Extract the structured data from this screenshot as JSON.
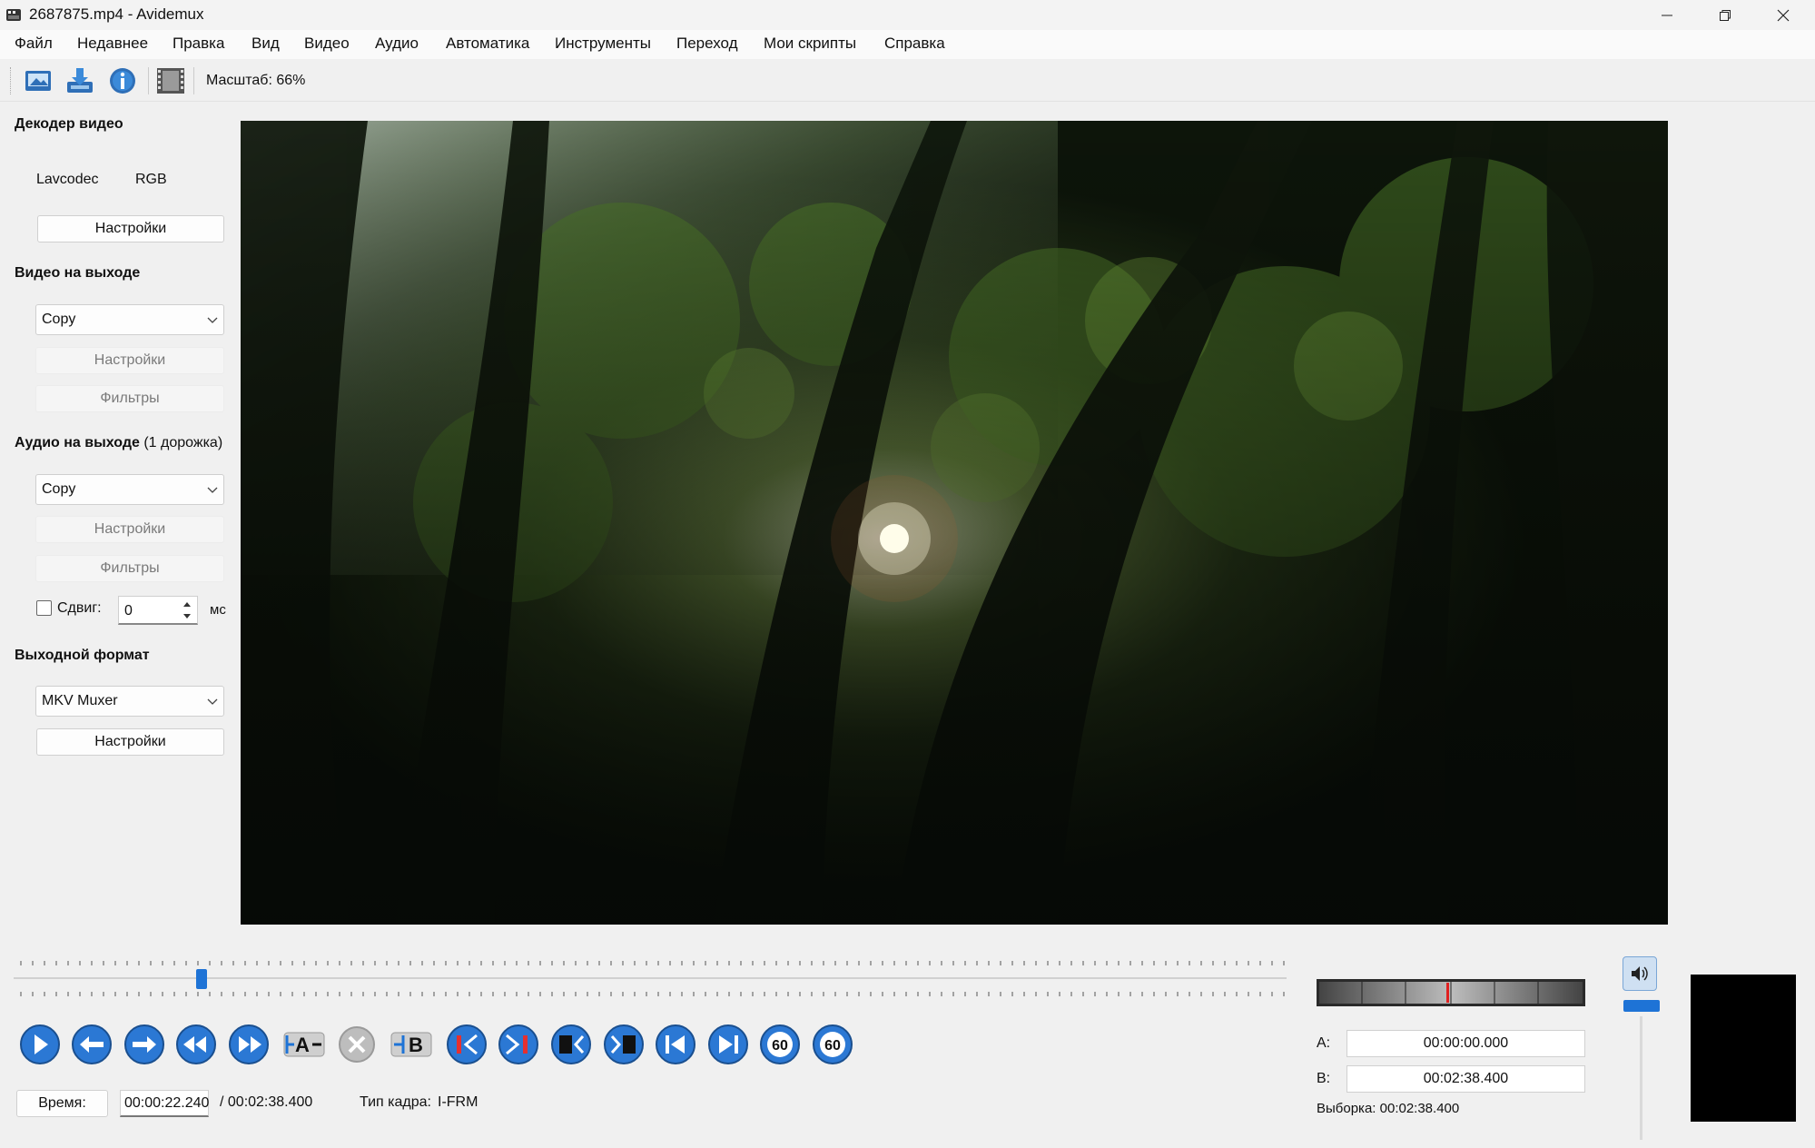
{
  "window": {
    "title": "2687875.mp4 - Avidemux"
  },
  "menu": [
    "Файл",
    "Недавнее",
    "Правка",
    "Вид",
    "Видео",
    "Аудио",
    "Автоматика",
    "Инструменты",
    "Переход",
    "Мои скрипты",
    "Справка"
  ],
  "toolbar": {
    "zoom": "Масштаб: 66%",
    "icons": [
      "open-icon",
      "save-icon",
      "info-icon",
      "filmstrip-icon"
    ]
  },
  "video_decoder": {
    "heading": "Декодер видео",
    "codec": "Lavcodec",
    "colorspace": "RGB",
    "settings": "Настройки"
  },
  "video_output": {
    "heading": "Видео на выходе",
    "codec": "Copy",
    "settings": "Настройки",
    "filters": "Фильтры"
  },
  "audio_output": {
    "heading": "Аудио на выходе",
    "tracks": "(1 дорожка)",
    "codec": "Copy",
    "settings": "Настройки",
    "filters": "Фильтры",
    "offset_label": "Сдвиг:",
    "offset_value": "0",
    "offset_unit": "мс",
    "offset_enabled": false
  },
  "output_format": {
    "heading": "Выходной формат",
    "muxer": "MKV Muxer",
    "settings": "Настройки"
  },
  "playback": {
    "position_fraction": 0.148,
    "time_label": "Время:",
    "current_time": "00:00:22.240",
    "total_time": "/ 00:02:38.400",
    "frame_type_label": "Тип кадра:",
    "frame_type": "I-FRM"
  },
  "transport": {
    "buttons": [
      "play-icon",
      "previous-frame-icon",
      "next-frame-icon",
      "rewind-icon",
      "fast-forward-icon",
      "set-marker-a-icon",
      "delete-icon",
      "set-marker-b-icon",
      "go-to-marker-a-icon",
      "go-to-marker-b-icon",
      "previous-keyframe-icon",
      "next-keyframe-icon",
      "go-to-start-icon",
      "go-to-end-icon",
      "back-60-icon",
      "forward-60-icon"
    ],
    "back_60": "60",
    "forward_60": "60",
    "marker_a": "A",
    "marker_b": "B"
  },
  "selection": {
    "a_label": "A:",
    "a_value": "00:00:00.000",
    "b_label": "B:",
    "b_value": "00:02:38.400",
    "selection_text": "Выборка: 00:02:38.400"
  },
  "colors": {
    "accent": "#1e73d6",
    "button_blue": "#2b78d4",
    "meter_marker": "#e02020"
  }
}
